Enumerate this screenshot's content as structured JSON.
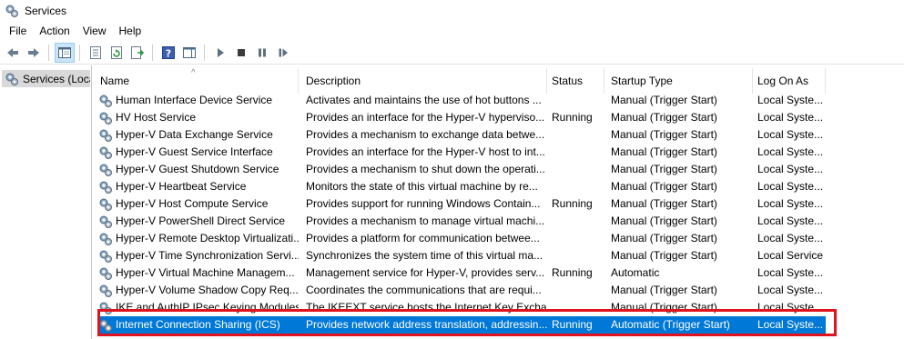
{
  "window": {
    "title": "Services",
    "icon": "services-gear-icon"
  },
  "menu": [
    "File",
    "Action",
    "View",
    "Help"
  ],
  "toolbar": {
    "buttons": [
      "back-arrow-icon",
      "forward-arrow-icon",
      "show-hide-console-tree-icon",
      "properties-icon",
      "refresh-icon",
      "export-list-icon",
      "help-icon",
      "action-pane-icon",
      "start-service-icon",
      "stop-service-icon",
      "pause-service-icon",
      "restart-service-icon"
    ]
  },
  "tree": {
    "selected": "Services (Local)"
  },
  "columns": [
    "Name",
    "Description",
    "Status",
    "Startup Type",
    "Log On As"
  ],
  "services": [
    {
      "name": "Human Interface Device Service",
      "desc": "Activates and maintains the use of hot buttons ...",
      "status": "",
      "startup": "Manual (Trigger Start)",
      "logon": "Local Syste..."
    },
    {
      "name": "HV Host Service",
      "desc": "Provides an interface for the Hyper-V hyperviso...",
      "status": "Running",
      "startup": "Manual (Trigger Start)",
      "logon": "Local Syste..."
    },
    {
      "name": "Hyper-V Data Exchange Service",
      "desc": "Provides a mechanism to exchange data betwe...",
      "status": "",
      "startup": "Manual (Trigger Start)",
      "logon": "Local Syste..."
    },
    {
      "name": "Hyper-V Guest Service Interface",
      "desc": "Provides an interface for the Hyper-V host to int...",
      "status": "",
      "startup": "Manual (Trigger Start)",
      "logon": "Local Syste..."
    },
    {
      "name": "Hyper-V Guest Shutdown Service",
      "desc": "Provides a mechanism to shut down the operati...",
      "status": "",
      "startup": "Manual (Trigger Start)",
      "logon": "Local Syste..."
    },
    {
      "name": "Hyper-V Heartbeat Service",
      "desc": "Monitors the state of this virtual machine by re...",
      "status": "",
      "startup": "Manual (Trigger Start)",
      "logon": "Local Syste..."
    },
    {
      "name": "Hyper-V Host Compute Service",
      "desc": "Provides support for running Windows Contain...",
      "status": "Running",
      "startup": "Manual (Trigger Start)",
      "logon": "Local Syste..."
    },
    {
      "name": "Hyper-V PowerShell Direct Service",
      "desc": "Provides a mechanism to manage virtual machi...",
      "status": "",
      "startup": "Manual (Trigger Start)",
      "logon": "Local Syste..."
    },
    {
      "name": "Hyper-V Remote Desktop Virtualizati...",
      "desc": "Provides a platform for communication betwee...",
      "status": "",
      "startup": "Manual (Trigger Start)",
      "logon": "Local Syste..."
    },
    {
      "name": "Hyper-V Time Synchronization Servi...",
      "desc": "Synchronizes the system time of this virtual ma...",
      "status": "",
      "startup": "Manual (Trigger Start)",
      "logon": "Local Service"
    },
    {
      "name": "Hyper-V Virtual Machine Managem...",
      "desc": "Management service for Hyper-V, provides serv...",
      "status": "Running",
      "startup": "Automatic",
      "logon": "Local Syste..."
    },
    {
      "name": "Hyper-V Volume Shadow Copy Req...",
      "desc": "Coordinates the communications that are requi...",
      "status": "",
      "startup": "Manual (Trigger Start)",
      "logon": "Local Syste..."
    },
    {
      "name": "IKE and AuthIP IPsec Keying Modules",
      "desc": "The IKEEXT service hosts the Internet Key Excha...",
      "status": "",
      "startup": "Manual (Trigger Start)",
      "logon": "Local Syste..."
    },
    {
      "name": "Internet Connection Sharing (ICS)",
      "desc": "Provides network address translation, addressin...",
      "status": "Running",
      "startup": "Automatic (Trigger Start)",
      "logon": "Local Syste...",
      "selected": true
    }
  ],
  "colors": {
    "selection": "#0078d7",
    "highlight_box": "#e0141e",
    "tree_selected": "#d9d9d9"
  }
}
